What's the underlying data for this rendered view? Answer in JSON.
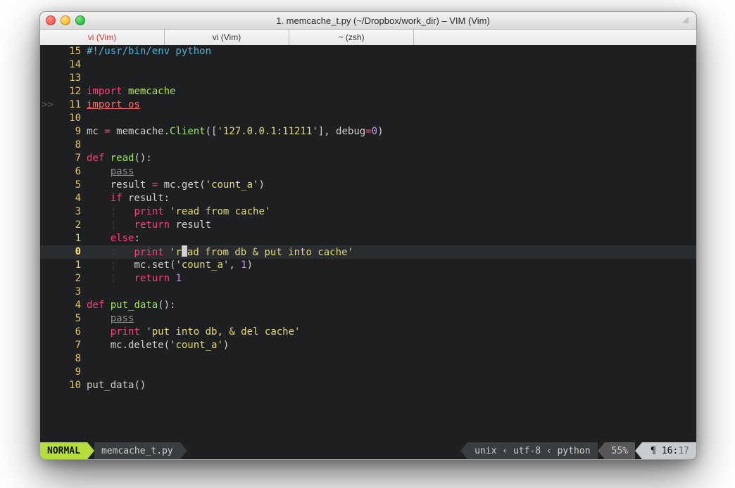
{
  "window": {
    "title": "1. memcache_t.py (~/Dropbox/work_dir) – VIM (Vim)"
  },
  "tabs": [
    "vi (Vim)",
    "vi (Vim)",
    "~ (zsh)"
  ],
  "tok": {
    "import": "import",
    "def": "def",
    "pass": "pass",
    "if": "if",
    "else": "else",
    "print": "print",
    "return": "return"
  },
  "lines": [
    {
      "n": "15",
      "shebang": "#!/usr/bin/env python"
    },
    {
      "n": "14"
    },
    {
      "n": "13"
    },
    {
      "n": "12",
      "mod": "memcache"
    },
    {
      "n": "11",
      "sign": ">>",
      "text": "import os"
    },
    {
      "n": "10"
    },
    {
      "n": "9",
      "addr": "'127.0.0.1:11211'",
      "debug": "0"
    },
    {
      "n": "8"
    },
    {
      "n": "7",
      "fn": "read"
    },
    {
      "n": "6"
    },
    {
      "n": "5",
      "key": "'count_a'"
    },
    {
      "n": "4"
    },
    {
      "n": "3",
      "str": "'read from cache'"
    },
    {
      "n": "2"
    },
    {
      "n": "1"
    },
    {
      "n": "0",
      "tail": "ad from db & put into cache'"
    },
    {
      "n": "1",
      "key": "'count_a'",
      "val": "1"
    },
    {
      "n": "2",
      "val": "1"
    },
    {
      "n": "3"
    },
    {
      "n": "4",
      "fn": "put_data"
    },
    {
      "n": "5"
    },
    {
      "n": "6",
      "str": "'put into db, & del cache'"
    },
    {
      "n": "7",
      "key": "'count_a'"
    },
    {
      "n": "8"
    },
    {
      "n": "9"
    },
    {
      "n": "10",
      "call": "put_data"
    }
  ],
  "status": {
    "mode": "NORMAL",
    "file": "memcache_t.py",
    "format": "unix",
    "encoding": "utf-8",
    "filetype": "python",
    "percent": "55%",
    "flag": "¶",
    "line": "16",
    "col": "17"
  }
}
